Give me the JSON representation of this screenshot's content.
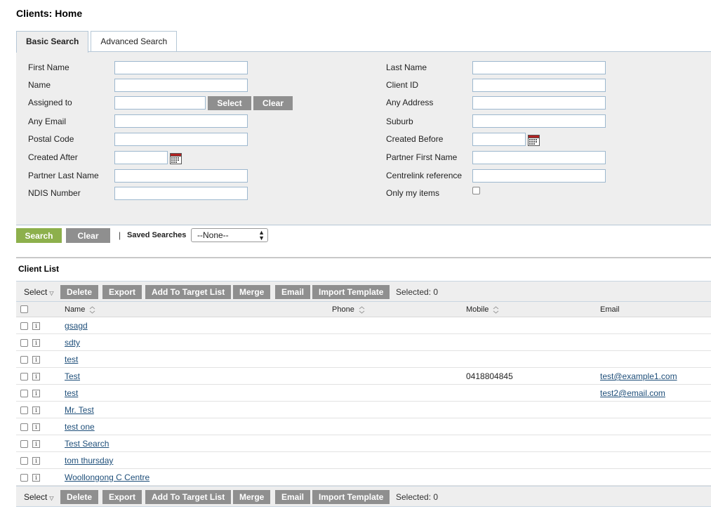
{
  "page": {
    "title": "Clients: Home"
  },
  "tabs": [
    {
      "label": "Basic Search"
    },
    {
      "label": "Advanced Search"
    }
  ],
  "search": {
    "left": [
      {
        "label": "First Name",
        "value": ""
      },
      {
        "label": "Name",
        "value": ""
      },
      {
        "label": "Assigned to",
        "value": "",
        "select_label": "Select",
        "clear_label": "Clear"
      },
      {
        "label": "Any Email",
        "value": ""
      },
      {
        "label": "Postal Code",
        "value": ""
      },
      {
        "label": "Created After",
        "value": ""
      },
      {
        "label": "Partner Last Name",
        "value": ""
      },
      {
        "label": "NDIS Number",
        "value": ""
      }
    ],
    "right": [
      {
        "label": "Last Name",
        "value": ""
      },
      {
        "label": "Client ID",
        "value": ""
      },
      {
        "label": "Any Address",
        "value": ""
      },
      {
        "label": "Suburb",
        "value": ""
      },
      {
        "label": "Created Before",
        "value": ""
      },
      {
        "label": "Partner First Name",
        "value": ""
      },
      {
        "label": "Centrelink reference",
        "value": ""
      },
      {
        "label": "Only my items",
        "checked": false
      }
    ],
    "search_label": "Search",
    "clear_label": "Clear",
    "separator": "|",
    "saved_searches_label": "Saved Searches",
    "saved_searches_value": "--None--"
  },
  "list": {
    "title": "Client List",
    "toolbar": {
      "select_label": "Select",
      "buttons": [
        "Delete",
        "Export",
        "Add To Target List",
        "Merge",
        "Email",
        "Import Template"
      ],
      "selected_text": "Selected: 0"
    },
    "columns": {
      "name": "Name",
      "phone": "Phone",
      "mobile": "Mobile",
      "email": "Email"
    },
    "info_glyph": "i",
    "rows": [
      {
        "name": "gsagd",
        "phone": "",
        "mobile": "",
        "email": ""
      },
      {
        "name": "sdty",
        "phone": "",
        "mobile": "",
        "email": ""
      },
      {
        "name": "test",
        "phone": "",
        "mobile": "",
        "email": ""
      },
      {
        "name": "Test",
        "phone": "",
        "mobile": "0418804845",
        "email": "test@example1.com"
      },
      {
        "name": "test",
        "phone": "",
        "mobile": "",
        "email": "test2@email.com"
      },
      {
        "name": "Mr. Test",
        "phone": "",
        "mobile": "",
        "email": ""
      },
      {
        "name": "test one",
        "phone": "",
        "mobile": "",
        "email": ""
      },
      {
        "name": "Test Search",
        "phone": "",
        "mobile": "",
        "email": ""
      },
      {
        "name": "tom thursday",
        "phone": "",
        "mobile": "",
        "email": ""
      },
      {
        "name": "Woollongong C Centre",
        "phone": "",
        "mobile": "",
        "email": ""
      }
    ]
  },
  "colors": {
    "search_button": "#8db04c",
    "gray_button": "#8f8f8f",
    "link": "#1f4f7a",
    "panel_bg": "#eeeeee"
  }
}
